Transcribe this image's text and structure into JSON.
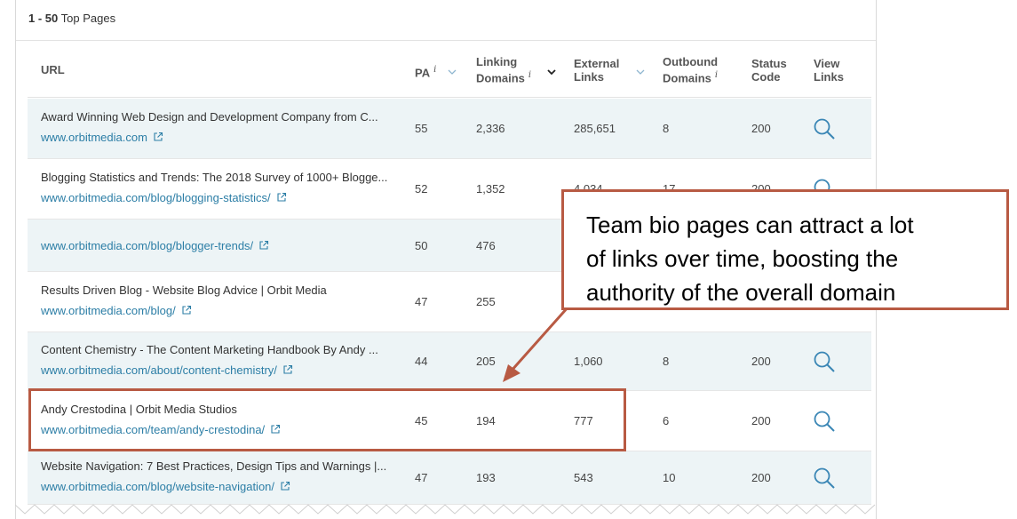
{
  "header": {
    "range": "1 - 50",
    "title": "Top Pages"
  },
  "columns": {
    "url": "URL",
    "pa": "PA",
    "linking_line1": "Linking",
    "linking_line2": "Domains",
    "external_line1": "External",
    "external_line2": "Links",
    "outbound_line1": "Outbound",
    "outbound_line2": "Domains",
    "status_line1": "Status",
    "status_line2": "Code",
    "view_line1": "View",
    "view_line2": "Links",
    "info_glyph": "i"
  },
  "rows": [
    {
      "title": "Award Winning Web Design and Development Company from C...",
      "url": "www.orbitmedia.com",
      "pa": "55",
      "linking_domains": "2,336",
      "external_links": "285,651",
      "outbound_domains": "8",
      "status": "200"
    },
    {
      "title": "Blogging Statistics and Trends: The 2018 Survey of 1000+ Blogge...",
      "url": "www.orbitmedia.com/blog/blogging-statistics/",
      "pa": "52",
      "linking_domains": "1,352",
      "external_links": "4,034",
      "outbound_domains": "17",
      "status": "200"
    },
    {
      "title": "",
      "url": "www.orbitmedia.com/blog/blogger-trends/",
      "pa": "50",
      "linking_domains": "476",
      "external_links": "",
      "outbound_domains": "",
      "status": ""
    },
    {
      "title": "Results Driven Blog - Website Blog Advice | Orbit Media",
      "url": "www.orbitmedia.com/blog/",
      "pa": "47",
      "linking_domains": "255",
      "external_links": "",
      "outbound_domains": "",
      "status": ""
    },
    {
      "title": "Content Chemistry - The Content Marketing Handbook By Andy ...",
      "url": "www.orbitmedia.com/about/content-chemistry/",
      "pa": "44",
      "linking_domains": "205",
      "external_links": "1,060",
      "outbound_domains": "8",
      "status": "200"
    },
    {
      "title": "Andy Crestodina | Orbit Media Studios",
      "url": "www.orbitmedia.com/team/andy-crestodina/",
      "pa": "45",
      "linking_domains": "194",
      "external_links": "777",
      "outbound_domains": "6",
      "status": "200"
    },
    {
      "title": "Website Navigation: 7 Best Practices, Design Tips and Warnings |...",
      "url": "www.orbitmedia.com/blog/website-navigation/",
      "pa": "47",
      "linking_domains": "193",
      "external_links": "543",
      "outbound_domains": "10",
      "status": "200"
    }
  ],
  "annotation": {
    "line1": "Team bio pages can attract a lot",
    "line2": "of links over time, boosting the",
    "line3": "authority of the overall domain",
    "color": "#b85a43"
  },
  "colors": {
    "link": "#2c7ea6",
    "row_alt": "#edf4f6",
    "icon": "#3a86b5"
  }
}
